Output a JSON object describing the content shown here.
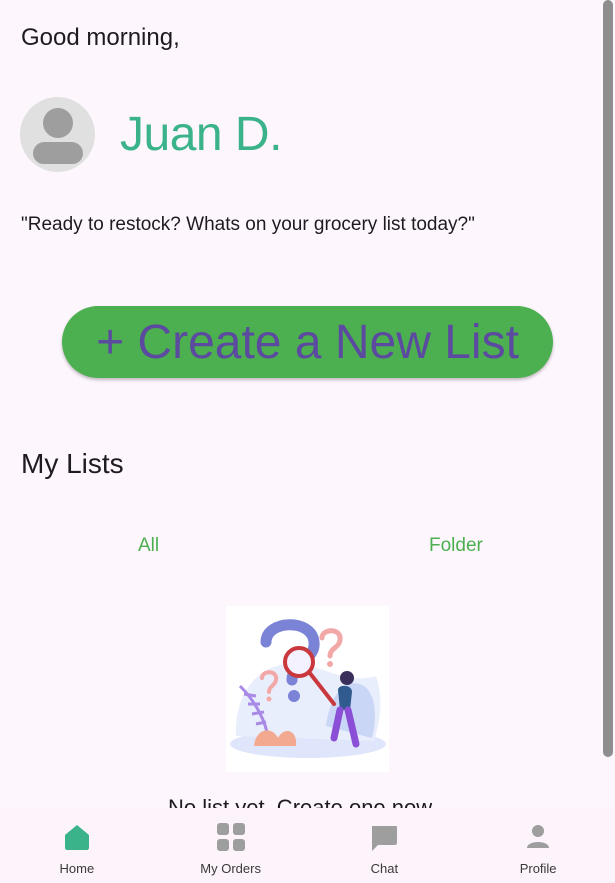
{
  "header": {
    "greeting": "Good morning,",
    "user_name": "Juan D.",
    "tagline": "\"Ready to restock? Whats on your grocery list today?\""
  },
  "actions": {
    "create_list_label": "+ Create a New List"
  },
  "lists": {
    "title": "My Lists",
    "tabs": [
      {
        "label": "All"
      },
      {
        "label": "Folder"
      }
    ],
    "empty_message": "No list yet. Create one now."
  },
  "bottom_nav": {
    "items": [
      {
        "label": "Home",
        "icon": "home-icon",
        "active": true
      },
      {
        "label": "My Orders",
        "icon": "grid-icon",
        "active": false
      },
      {
        "label": "Chat",
        "icon": "chat-icon",
        "active": false
      },
      {
        "label": "Profile",
        "icon": "person-icon",
        "active": false
      }
    ]
  },
  "colors": {
    "accent_green": "#4caf50",
    "name_teal": "#3bb38a",
    "button_text_purple": "#5b4aa0",
    "background": "#fdf6fd"
  }
}
